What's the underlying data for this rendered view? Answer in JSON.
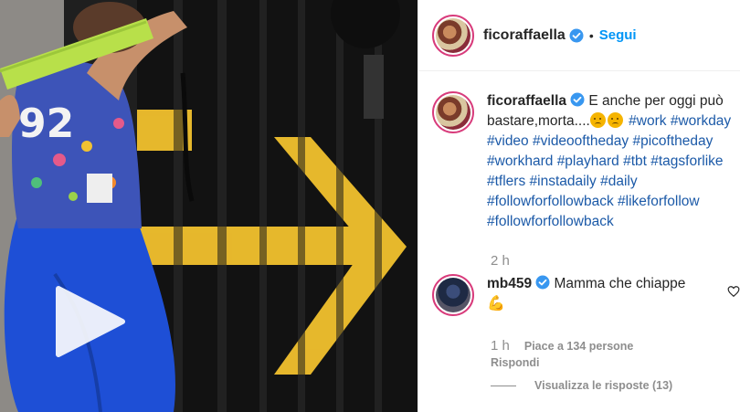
{
  "post": {
    "author": "ficoraffaella",
    "follow_label": "Segui",
    "separator": "•",
    "caption_text": "E anche per oggi può bastare,morta....",
    "hashtags": [
      "#work",
      "#workday",
      "#video",
      "#videooftheday",
      "#picoftheday",
      "#workhard",
      "#playhard",
      "#tbt",
      "#tagsforlike",
      "#tflers",
      "#instadaily",
      "#daily",
      "#followforfollowback",
      "#likeforfollow",
      "#followforfollowback"
    ],
    "caption_time": "2 h"
  },
  "comment": {
    "author": "mb459",
    "text": "Mamma che chiappe",
    "emoji_glyph": "💪",
    "time": "1 h",
    "likes": "Piace a 134 persone",
    "reply_label": "Rispondi",
    "view_replies_label": "Visualizza le risposte (13)"
  },
  "colors": {
    "follow_blue": "#0095f6",
    "hashtag_blue": "#1c5aa8",
    "verified_blue": "#3897f0",
    "muted": "#8e8e8e"
  },
  "icons": {
    "media_control": "play-icon",
    "verified": "verified-badge-icon",
    "like": "heart-icon"
  }
}
